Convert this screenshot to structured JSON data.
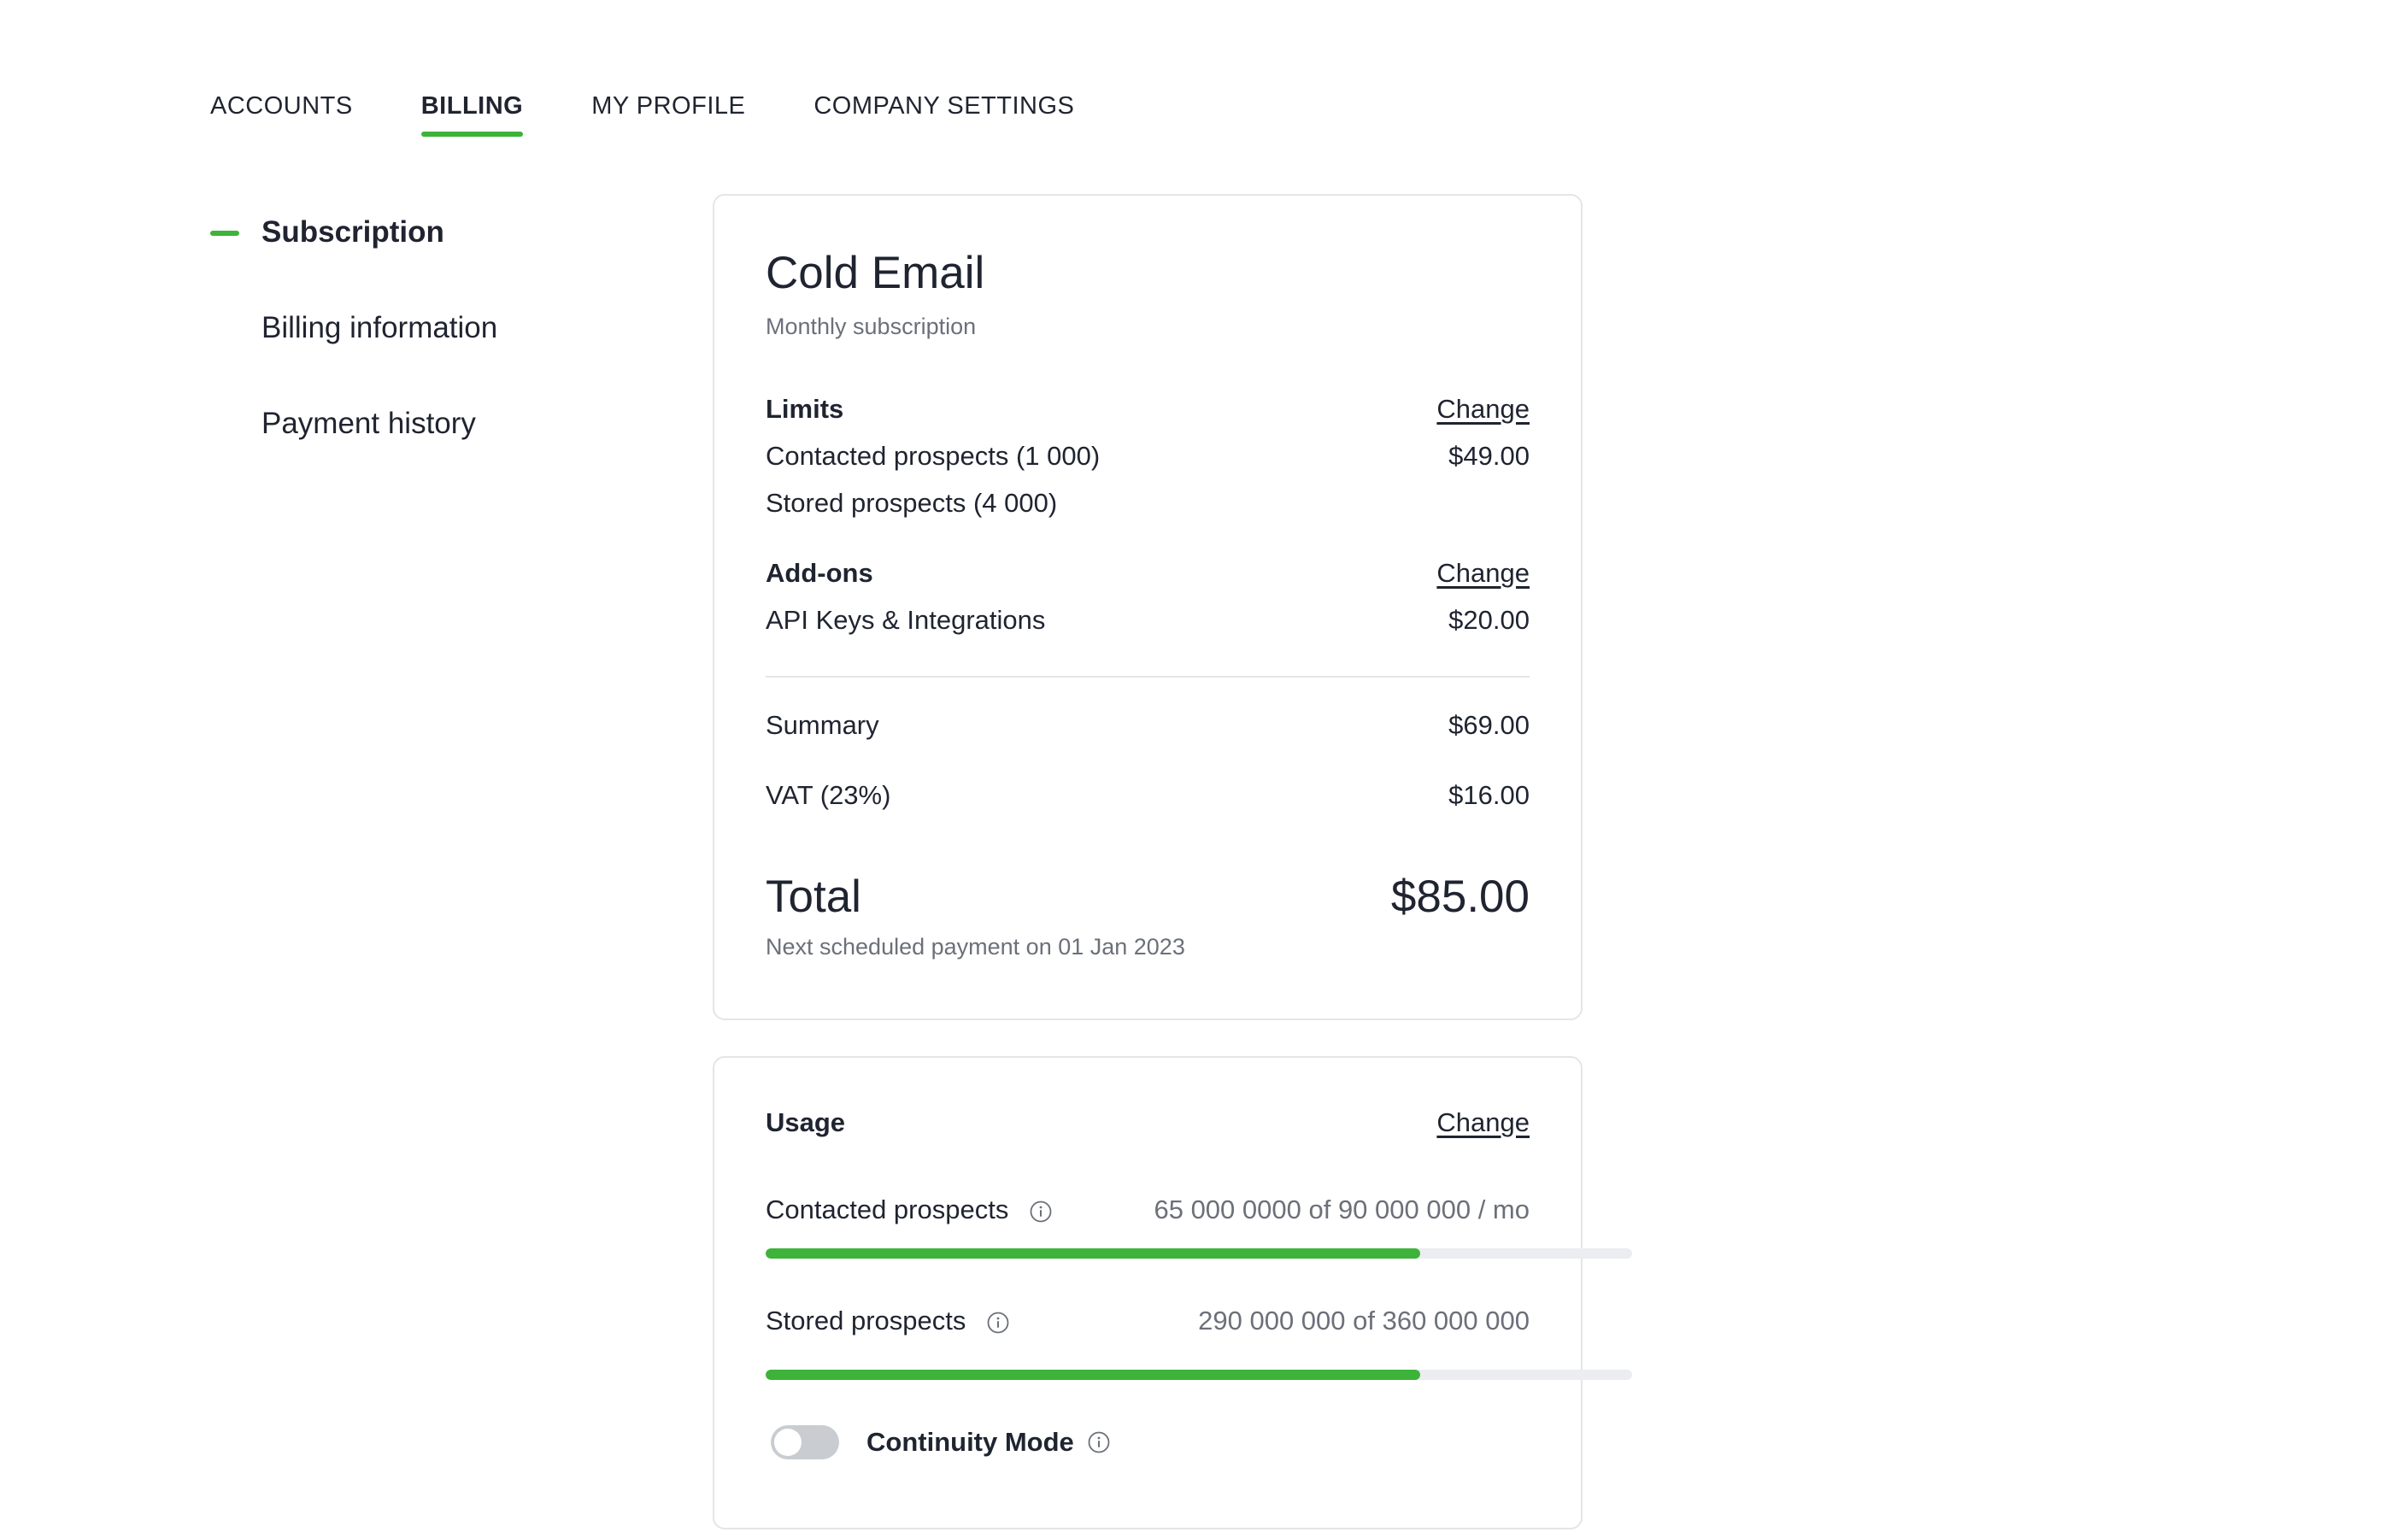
{
  "tabs": [
    {
      "label": "ACCOUNTS",
      "active": false
    },
    {
      "label": "BILLING",
      "active": true
    },
    {
      "label": "MY PROFILE",
      "active": false
    },
    {
      "label": "COMPANY SETTINGS",
      "active": false
    }
  ],
  "sidebar": {
    "items": [
      {
        "label": "Subscription",
        "active": true
      },
      {
        "label": "Billing information",
        "active": false
      },
      {
        "label": "Payment history",
        "active": false
      }
    ]
  },
  "subscription": {
    "title": "Cold Email",
    "subtitle": "Monthly subscription",
    "limits": {
      "heading": "Limits",
      "change_label": "Change",
      "contacted_label": "Contacted prospects (1 000)",
      "contacted_price": "$49.00",
      "stored_label": "Stored prospects (4 000)"
    },
    "addons": {
      "heading": "Add-ons",
      "change_label": "Change",
      "api_label": "API Keys & Integrations",
      "api_price": "$20.00"
    },
    "summary_label": "Summary",
    "summary_value": "$69.00",
    "vat_label": "VAT (23%)",
    "vat_value": "$16.00",
    "total_label": "Total",
    "total_value": "$85.00",
    "next_payment": "Next scheduled payment on 01 Jan 2023"
  },
  "usage": {
    "heading": "Usage",
    "change_label": "Change",
    "contacted": {
      "label": "Contacted prospects",
      "value": "65 000 0000 of 90 000 000 / mo",
      "fraction": 0.755,
      "icon": "info-icon"
    },
    "stored": {
      "label": "Stored prospects",
      "value": "290 000 000 of 360 000 000",
      "fraction": 0.755,
      "icon": "info-icon"
    },
    "continuity": {
      "label": "Continuity Mode",
      "enabled": false,
      "icon": "info-icon"
    }
  },
  "colors": {
    "accent": "#3db33a",
    "text": "#1f2430",
    "muted": "#6b7079",
    "border": "#e3e5e8",
    "track": "#ebedf0",
    "toggle_off": "#c9ccd1"
  }
}
